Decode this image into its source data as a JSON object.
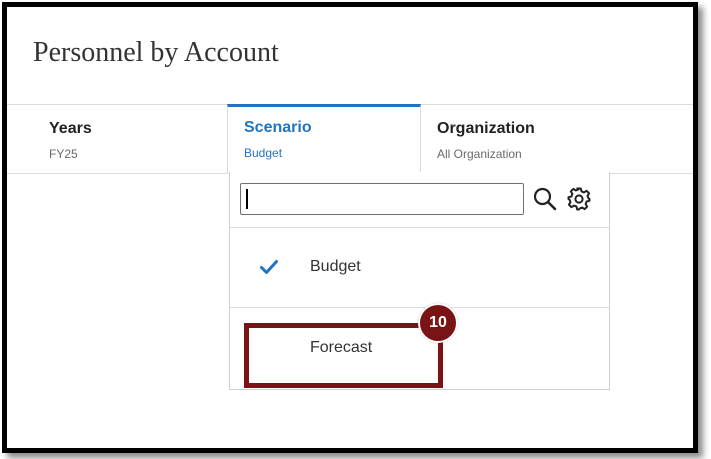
{
  "page": {
    "title": "Personnel by Account"
  },
  "pov": {
    "items": [
      {
        "label": "Years",
        "value": "FY25"
      },
      {
        "label": "Scenario",
        "value": "Budget"
      },
      {
        "label": "Organization",
        "value": "All Organization"
      }
    ]
  },
  "dropdown": {
    "search_value": "",
    "options": [
      {
        "label": "Budget",
        "selected": true
      },
      {
        "label": "Forecast",
        "selected": false
      }
    ]
  },
  "annotation": {
    "step_number": "10"
  },
  "colors": {
    "accent": "#1f74c4",
    "highlight": "#7a1315",
    "frame": "#000000"
  },
  "icons": {
    "search": "search-icon",
    "settings": "gear-icon",
    "selected": "checkmark-icon"
  }
}
